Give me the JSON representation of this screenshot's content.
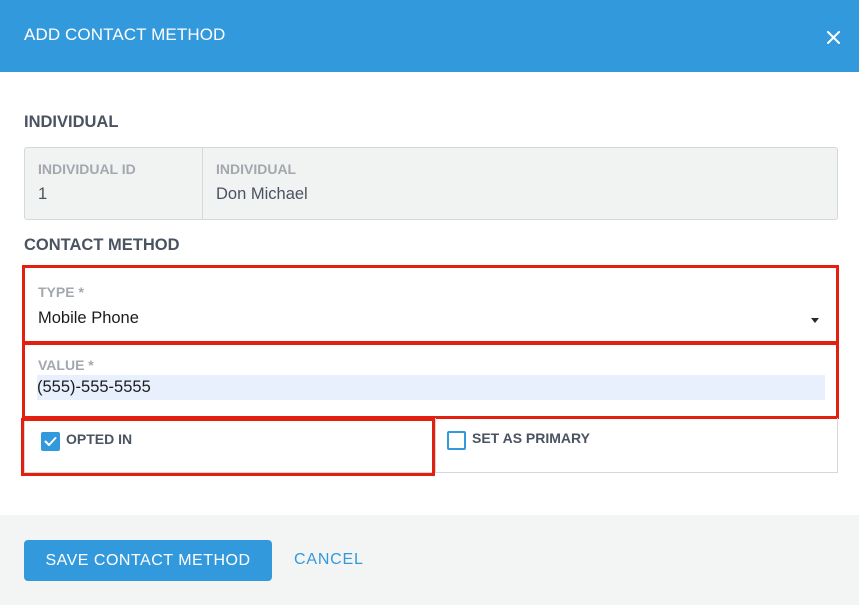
{
  "dialog": {
    "title": "ADD CONTACT METHOD",
    "close_icon": "close-icon"
  },
  "individual_section": {
    "heading": "INDIVIDUAL",
    "fields": [
      {
        "label": "INDIVIDUAL ID",
        "value": "1"
      },
      {
        "label": "INDIVIDUAL",
        "value": "Don Michael"
      }
    ]
  },
  "contact_section": {
    "heading": "CONTACT METHOD",
    "type": {
      "label": "TYPE *",
      "value": "Mobile Phone"
    },
    "value": {
      "label": "VALUE *",
      "value": "(555)-555-5555"
    },
    "opted_in": {
      "label": "OPTED IN",
      "checked": true
    },
    "set_primary": {
      "label": "SET AS PRIMARY",
      "checked": false
    }
  },
  "footer": {
    "save_label": "SAVE CONTACT METHOD",
    "cancel_label": "CANCEL"
  },
  "colors": {
    "accent": "#3399dd",
    "highlight_border": "#e3200f",
    "autofill_bg": "#e8f0fe"
  }
}
